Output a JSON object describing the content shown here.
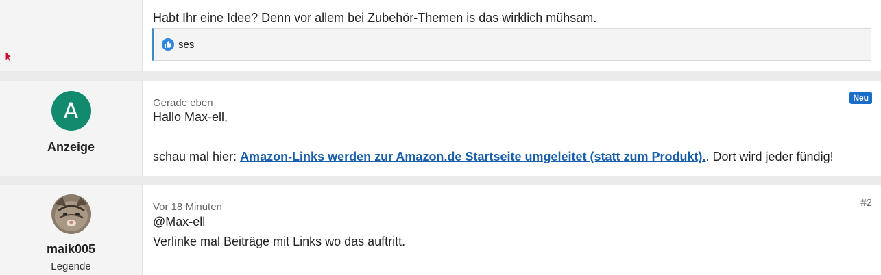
{
  "post_prev": {
    "text": "Habt Ihr eine Idee? Denn vor allem bei Zubehör-Themen is das wirklich mühsam.",
    "reaction": {
      "icon": "thumbs-up-icon",
      "user": "ses"
    }
  },
  "post_ad": {
    "avatar_letter": "A",
    "username": "Anzeige",
    "time": "Gerade eben",
    "badge": "Neu",
    "greeting": "Hallo Max-ell,",
    "text_before": "schau mal hier: ",
    "link_text": "Amazon-Links werden zur Amazon.de Startseite umgeleitet (statt zum Produkt).",
    "text_after": ". Dort wird jeder fündig!"
  },
  "post_2": {
    "username": "maik005",
    "role": "Legende",
    "time": "Vor 18 Minuten",
    "number": "#2",
    "line1": "@Max-ell",
    "line2": "Verlinke mal Beiträge mit Links wo das auftritt."
  },
  "colors": {
    "accent": "#1a6ec8",
    "link": "#1a5fab",
    "avatar_bg": "#128a6e"
  }
}
